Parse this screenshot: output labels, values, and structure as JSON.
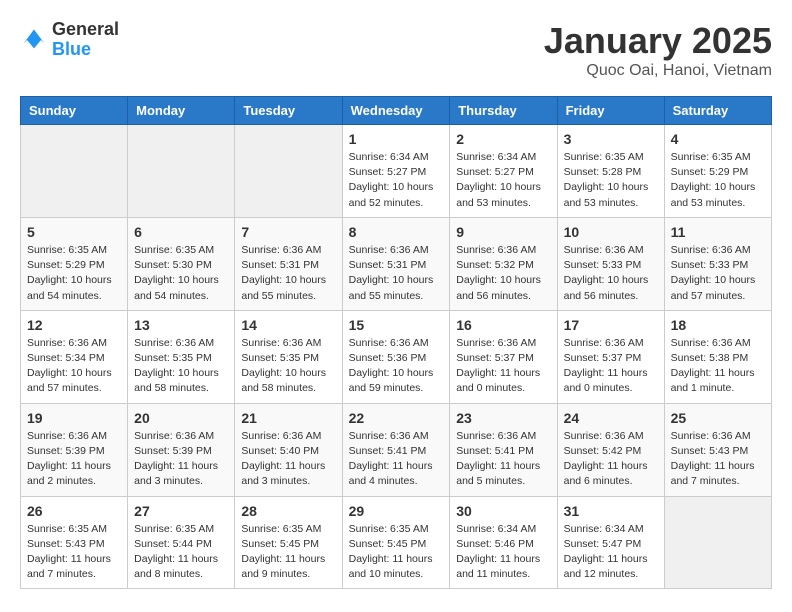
{
  "header": {
    "logo_general": "General",
    "logo_blue": "Blue",
    "title": "January 2025",
    "subtitle": "Quoc Oai, Hanoi, Vietnam"
  },
  "calendar": {
    "days_of_week": [
      "Sunday",
      "Monday",
      "Tuesday",
      "Wednesday",
      "Thursday",
      "Friday",
      "Saturday"
    ],
    "weeks": [
      [
        {
          "day": "",
          "info": ""
        },
        {
          "day": "",
          "info": ""
        },
        {
          "day": "",
          "info": ""
        },
        {
          "day": "1",
          "info": "Sunrise: 6:34 AM\nSunset: 5:27 PM\nDaylight: 10 hours\nand 52 minutes."
        },
        {
          "day": "2",
          "info": "Sunrise: 6:34 AM\nSunset: 5:27 PM\nDaylight: 10 hours\nand 53 minutes."
        },
        {
          "day": "3",
          "info": "Sunrise: 6:35 AM\nSunset: 5:28 PM\nDaylight: 10 hours\nand 53 minutes."
        },
        {
          "day": "4",
          "info": "Sunrise: 6:35 AM\nSunset: 5:29 PM\nDaylight: 10 hours\nand 53 minutes."
        }
      ],
      [
        {
          "day": "5",
          "info": "Sunrise: 6:35 AM\nSunset: 5:29 PM\nDaylight: 10 hours\nand 54 minutes."
        },
        {
          "day": "6",
          "info": "Sunrise: 6:35 AM\nSunset: 5:30 PM\nDaylight: 10 hours\nand 54 minutes."
        },
        {
          "day": "7",
          "info": "Sunrise: 6:36 AM\nSunset: 5:31 PM\nDaylight: 10 hours\nand 55 minutes."
        },
        {
          "day": "8",
          "info": "Sunrise: 6:36 AM\nSunset: 5:31 PM\nDaylight: 10 hours\nand 55 minutes."
        },
        {
          "day": "9",
          "info": "Sunrise: 6:36 AM\nSunset: 5:32 PM\nDaylight: 10 hours\nand 56 minutes."
        },
        {
          "day": "10",
          "info": "Sunrise: 6:36 AM\nSunset: 5:33 PM\nDaylight: 10 hours\nand 56 minutes."
        },
        {
          "day": "11",
          "info": "Sunrise: 6:36 AM\nSunset: 5:33 PM\nDaylight: 10 hours\nand 57 minutes."
        }
      ],
      [
        {
          "day": "12",
          "info": "Sunrise: 6:36 AM\nSunset: 5:34 PM\nDaylight: 10 hours\nand 57 minutes."
        },
        {
          "day": "13",
          "info": "Sunrise: 6:36 AM\nSunset: 5:35 PM\nDaylight: 10 hours\nand 58 minutes."
        },
        {
          "day": "14",
          "info": "Sunrise: 6:36 AM\nSunset: 5:35 PM\nDaylight: 10 hours\nand 58 minutes."
        },
        {
          "day": "15",
          "info": "Sunrise: 6:36 AM\nSunset: 5:36 PM\nDaylight: 10 hours\nand 59 minutes."
        },
        {
          "day": "16",
          "info": "Sunrise: 6:36 AM\nSunset: 5:37 PM\nDaylight: 11 hours\nand 0 minutes."
        },
        {
          "day": "17",
          "info": "Sunrise: 6:36 AM\nSunset: 5:37 PM\nDaylight: 11 hours\nand 0 minutes."
        },
        {
          "day": "18",
          "info": "Sunrise: 6:36 AM\nSunset: 5:38 PM\nDaylight: 11 hours\nand 1 minute."
        }
      ],
      [
        {
          "day": "19",
          "info": "Sunrise: 6:36 AM\nSunset: 5:39 PM\nDaylight: 11 hours\nand 2 minutes."
        },
        {
          "day": "20",
          "info": "Sunrise: 6:36 AM\nSunset: 5:39 PM\nDaylight: 11 hours\nand 3 minutes."
        },
        {
          "day": "21",
          "info": "Sunrise: 6:36 AM\nSunset: 5:40 PM\nDaylight: 11 hours\nand 3 minutes."
        },
        {
          "day": "22",
          "info": "Sunrise: 6:36 AM\nSunset: 5:41 PM\nDaylight: 11 hours\nand 4 minutes."
        },
        {
          "day": "23",
          "info": "Sunrise: 6:36 AM\nSunset: 5:41 PM\nDaylight: 11 hours\nand 5 minutes."
        },
        {
          "day": "24",
          "info": "Sunrise: 6:36 AM\nSunset: 5:42 PM\nDaylight: 11 hours\nand 6 minutes."
        },
        {
          "day": "25",
          "info": "Sunrise: 6:36 AM\nSunset: 5:43 PM\nDaylight: 11 hours\nand 7 minutes."
        }
      ],
      [
        {
          "day": "26",
          "info": "Sunrise: 6:35 AM\nSunset: 5:43 PM\nDaylight: 11 hours\nand 7 minutes."
        },
        {
          "day": "27",
          "info": "Sunrise: 6:35 AM\nSunset: 5:44 PM\nDaylight: 11 hours\nand 8 minutes."
        },
        {
          "day": "28",
          "info": "Sunrise: 6:35 AM\nSunset: 5:45 PM\nDaylight: 11 hours\nand 9 minutes."
        },
        {
          "day": "29",
          "info": "Sunrise: 6:35 AM\nSunset: 5:45 PM\nDaylight: 11 hours\nand 10 minutes."
        },
        {
          "day": "30",
          "info": "Sunrise: 6:34 AM\nSunset: 5:46 PM\nDaylight: 11 hours\nand 11 minutes."
        },
        {
          "day": "31",
          "info": "Sunrise: 6:34 AM\nSunset: 5:47 PM\nDaylight: 11 hours\nand 12 minutes."
        },
        {
          "day": "",
          "info": ""
        }
      ]
    ]
  }
}
